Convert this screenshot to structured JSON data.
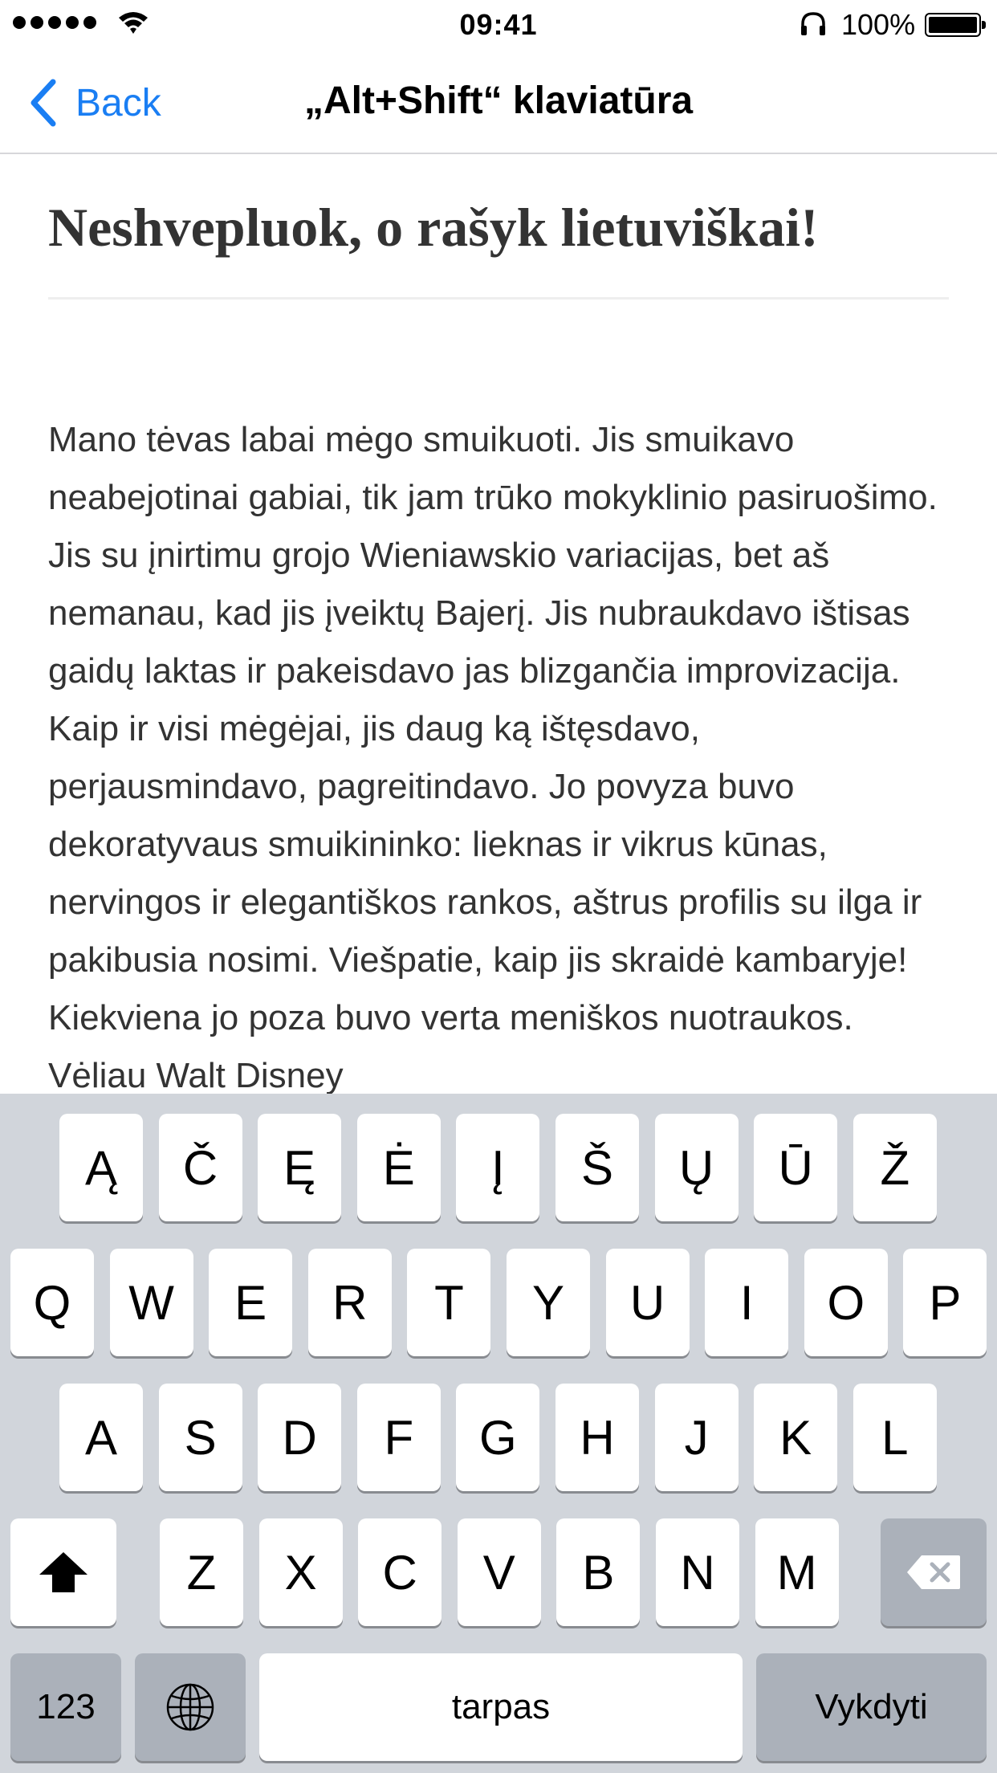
{
  "status_bar": {
    "time": "09:41",
    "battery_percent": "100%",
    "signal_dots": 5,
    "battery_level": 1.0
  },
  "nav": {
    "back_label": "Back",
    "title": "„Alt+Shift“ klaviatūra"
  },
  "article": {
    "title": "Neshvepluok, o rašyk lietuviškai!",
    "body": "Mano tėvas labai mėgo smuikuoti. Jis smuikavo neabejotinai gabiai, tik jam trūko mokyklinio pasiruošimo. Jis su įnirtimu grojo Wieniawskio variacijas, bet aš nemanau, kad jis įveiktų Bajerį. Jis nubraukdavo ištisas gaidų laktas ir pakeisdavo jas blizgančia improvizacija. Kaip ir visi mėgėjai, jis daug ką ištęsdavo, perjausmindavo, pagreitindavo. Jo povyza buvo dekoratyvaus smuikininko: lieknas ir vikrus kūnas, nervingos ir elegantiškos rankos, aštrus profilis su ilga ir pakibusia nosimi. Viešpatie, kaip jis skraidė kambaryje! Kiekviena jo poza buvo verta meniškos nuotraukos. Vėliau Walt Disney"
  },
  "keyboard": {
    "row0": [
      "Ą",
      "Č",
      "Ę",
      "Ė",
      "Į",
      "Š",
      "Ų",
      "Ū",
      "Ž"
    ],
    "row1": [
      "Q",
      "W",
      "E",
      "R",
      "T",
      "Y",
      "U",
      "I",
      "O",
      "P"
    ],
    "row2": [
      "A",
      "S",
      "D",
      "F",
      "G",
      "H",
      "J",
      "K",
      "L"
    ],
    "row3": [
      "Z",
      "X",
      "C",
      "V",
      "B",
      "N",
      "M"
    ],
    "numbers_label": "123",
    "space_label": "tarpas",
    "return_label": "Vykdyti",
    "shift_icon": "shift-arrow-icon",
    "delete_icon": "backspace-icon",
    "globe_icon": "globe-icon"
  },
  "colors": {
    "accent": "#1a7ef3",
    "keyboard_bg": "#d1d5db",
    "special_key_bg": "#abb1ba",
    "text": "#333333"
  }
}
